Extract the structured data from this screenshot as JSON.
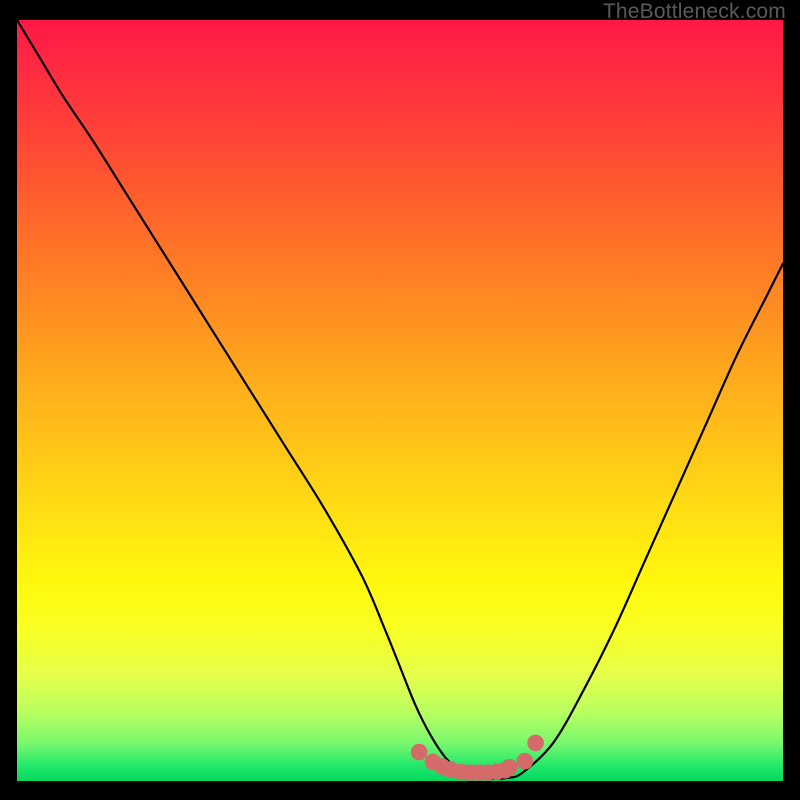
{
  "watermark": "TheBottleneck.com",
  "colors": {
    "curve": "#000000",
    "marker": "#d46a6a",
    "marker_stroke": "#d46a6a"
  },
  "chart_data": {
    "type": "line",
    "title": "",
    "xlabel": "",
    "ylabel": "",
    "xlim": [
      0,
      100
    ],
    "ylim": [
      0,
      100
    ],
    "series": [
      {
        "name": "curve",
        "x": [
          0,
          3,
          6,
          10,
          15,
          20,
          25,
          30,
          35,
          40,
          45,
          48,
          50,
          52,
          54,
          56,
          58,
          60,
          62,
          64,
          66,
          70,
          74,
          78,
          82,
          86,
          90,
          94,
          98,
          100
        ],
        "y": [
          100,
          95,
          90,
          84,
          76,
          68,
          60,
          52,
          44,
          36,
          27,
          20,
          15,
          10,
          6,
          3,
          1.3,
          0.5,
          0.3,
          0.4,
          1.1,
          5,
          12,
          20,
          29,
          38,
          47,
          56,
          64,
          68
        ]
      }
    ],
    "markers": {
      "name": "bottom-cluster",
      "x": [
        52.5,
        54.3,
        55.5,
        56.6,
        58.0,
        59.2,
        60.3,
        61.4,
        62.6,
        63.7,
        64.3,
        66.3,
        67.7
      ],
      "y": [
        3.8,
        2.5,
        1.9,
        1.5,
        1.2,
        1.1,
        1.1,
        1.1,
        1.2,
        1.4,
        1.8,
        2.6,
        5.0
      ]
    }
  }
}
